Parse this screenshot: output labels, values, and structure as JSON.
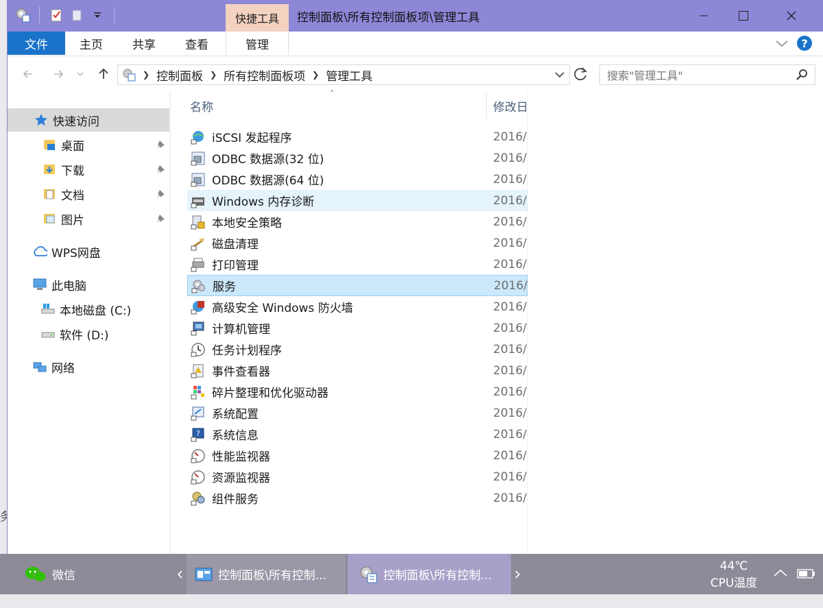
{
  "window": {
    "title": "控制面板\\所有控制面板项\\管理工具",
    "context_tab": "快捷工具",
    "accent": "#8d87d8"
  },
  "ribbon": {
    "tabs": [
      {
        "label": "文件"
      },
      {
        "label": "主页"
      },
      {
        "label": "共享"
      },
      {
        "label": "查看"
      },
      {
        "label": "管理"
      }
    ]
  },
  "address": {
    "crumbs": [
      "控制面板",
      "所有控制面板项",
      "管理工具"
    ],
    "search_placeholder": "搜索\"管理工具\""
  },
  "nav": {
    "quick_access": "快速访问",
    "items": [
      {
        "label": "桌面",
        "icon": "desktop-folder-icon"
      },
      {
        "label": "下载",
        "icon": "download-folder-icon"
      },
      {
        "label": "文档",
        "icon": "documents-folder-icon"
      },
      {
        "label": "图片",
        "icon": "pictures-folder-icon"
      }
    ],
    "wps": "WPS网盘",
    "this_pc": "此电脑",
    "drives": [
      {
        "label": "本地磁盘 (C:)"
      },
      {
        "label": "软件 (D:)"
      }
    ],
    "network": "网络"
  },
  "columns": {
    "name": "名称",
    "modified": "修改日"
  },
  "files": [
    {
      "name": "iSCSI 发起程序",
      "date": "2016/",
      "icon": "iscsi-icon"
    },
    {
      "name": "ODBC 数据源(32 位)",
      "date": "2016/",
      "icon": "odbc-icon"
    },
    {
      "name": "ODBC 数据源(64 位)",
      "date": "2016/",
      "icon": "odbc-icon"
    },
    {
      "name": "Windows 内存诊断",
      "date": "2016/",
      "icon": "memory-diagnostic-icon"
    },
    {
      "name": "本地安全策略",
      "date": "2016/",
      "icon": "security-policy-icon"
    },
    {
      "name": "磁盘清理",
      "date": "2016/",
      "icon": "disk-cleanup-icon"
    },
    {
      "name": "打印管理",
      "date": "2016/",
      "icon": "print-management-icon"
    },
    {
      "name": "服务",
      "date": "2016/",
      "icon": "services-icon"
    },
    {
      "name": "高级安全 Windows 防火墙",
      "date": "2016/",
      "icon": "firewall-icon"
    },
    {
      "name": "计算机管理",
      "date": "2016/",
      "icon": "computer-management-icon"
    },
    {
      "name": "任务计划程序",
      "date": "2016/",
      "icon": "task-scheduler-icon"
    },
    {
      "name": "事件查看器",
      "date": "2016/",
      "icon": "event-viewer-icon"
    },
    {
      "name": "碎片整理和优化驱动器",
      "date": "2016/",
      "icon": "defrag-icon"
    },
    {
      "name": "系统配置",
      "date": "2016/",
      "icon": "system-config-icon"
    },
    {
      "name": "系统信息",
      "date": "2016/",
      "icon": "system-info-icon"
    },
    {
      "name": "性能监视器",
      "date": "2016/",
      "icon": "performance-monitor-icon"
    },
    {
      "name": "资源监视器",
      "date": "2016/",
      "icon": "resource-monitor-icon"
    },
    {
      "name": "组件服务",
      "date": "2016/",
      "icon": "component-services-icon"
    }
  ],
  "taskbar": {
    "wechat": "微信",
    "items": [
      {
        "label": "控制面板\\所有控制..."
      },
      {
        "label": "控制面板\\所有控制..."
      }
    ],
    "temp": "44℃",
    "temp_label": "CPU温度"
  }
}
